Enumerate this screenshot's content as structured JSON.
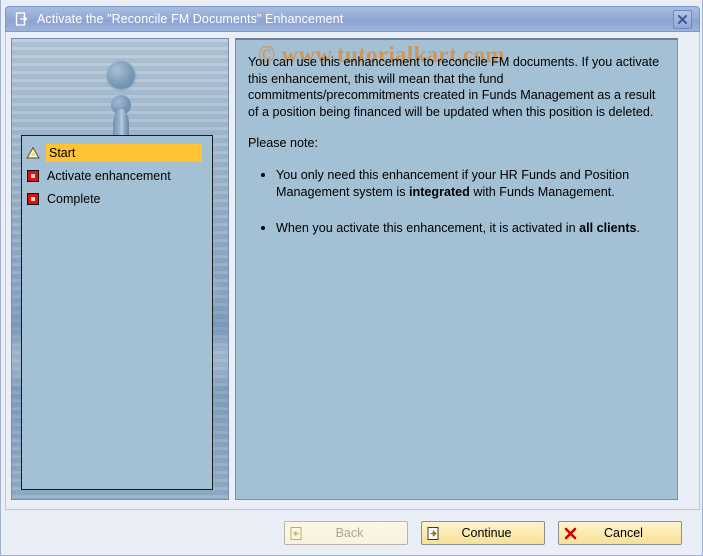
{
  "window": {
    "title": "Activate the \"Reconcile FM Documents\" Enhancement",
    "title_icon": "document-arrow-icon",
    "close_icon": "close-icon",
    "colors": {
      "titlebar": "#8ca4d2",
      "panel": "#a3c0d4",
      "selection": "#ffc333",
      "button": "#f7e09a",
      "watermark": "#d98b3a"
    }
  },
  "nav": {
    "items": [
      {
        "label": "Start",
        "icon": "warning-triangle-icon",
        "selected": true
      },
      {
        "label": "Activate enhancement",
        "icon": "red-square-icon",
        "selected": false
      },
      {
        "label": "Complete",
        "icon": "red-square-icon",
        "selected": false
      }
    ]
  },
  "content": {
    "watermark": "© www.tutorialkart.com",
    "paragraph1": "You can use this enhancement to reconcile FM documents. If you activate this enhancement, this will mean that the fund commitments/precommitments created in Funds Management as a result of a position being financed will be updated when this position is deleted.",
    "paragraph2": "Please note:",
    "bullets": [
      {
        "part1": "You only need this enhancement if your HR Funds and Position Management system is ",
        "bold1": "integrated",
        "part2": " with Funds Management.",
        "bold2": "",
        "part3": ""
      },
      {
        "part1": "When you activate this enhancement, it is activated in ",
        "bold1": "all clients",
        "part2": ".",
        "bold2": "",
        "part3": ""
      }
    ]
  },
  "buttons": {
    "back": {
      "label": "Back",
      "icon": "back-document-icon",
      "disabled": true
    },
    "continue": {
      "label": "Continue",
      "icon": "continue-document-icon",
      "disabled": false
    },
    "cancel": {
      "label": "Cancel",
      "icon": "cancel-cross-icon",
      "disabled": false
    }
  }
}
